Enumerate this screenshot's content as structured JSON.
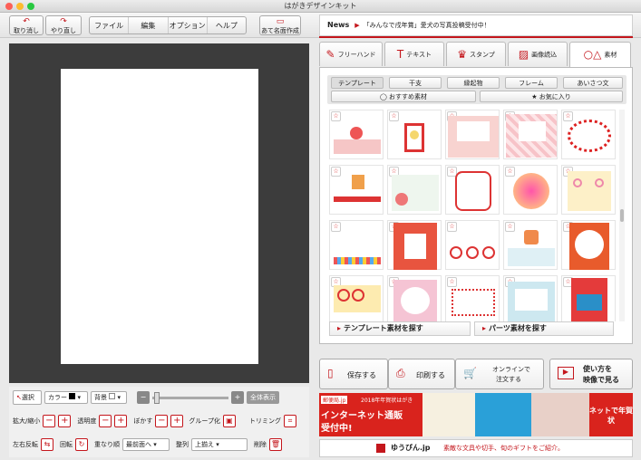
{
  "window": {
    "title": "はがきデザインキット"
  },
  "toolbar": {
    "undo": "取り消し",
    "redo": "やり直し",
    "menu": [
      "ファイル",
      "編集",
      "オプション",
      "ヘルプ"
    ],
    "address": "あて名面作成"
  },
  "news": {
    "label": "News",
    "text": "「みんなで戌年賞」愛犬の写真投稿受付中！"
  },
  "tabs": [
    {
      "label": "フリーハンド",
      "icon": "pen-icon"
    },
    {
      "label": "テキスト",
      "icon": "text-icon"
    },
    {
      "label": "スタンプ",
      "icon": "stamp-icon"
    },
    {
      "label": "画像読込",
      "icon": "image-icon"
    },
    {
      "label": "素材",
      "icon": "shapes-icon"
    }
  ],
  "categories": [
    "テンプレート",
    "干支",
    "縁起物",
    "フレーム",
    "あいさつ文"
  ],
  "recommend": "おすすめ素材",
  "favorites": "お気に入り",
  "search": {
    "template": "テンプレート素材を探す",
    "parts": "パーツ素材を探す"
  },
  "actions": {
    "save": "保存する",
    "print": "印刷する",
    "online1": "オンラインで",
    "online2": "注文する",
    "video1": "使い方を",
    "video2": "映像で見る"
  },
  "tools": {
    "select": "選択",
    "color": "カラー",
    "background": "背景",
    "fullview": "全体表示",
    "zoom": "拡大/縮小",
    "opacity": "透明度",
    "blur": "ぼかす",
    "group": "グループ化",
    "trim": "トリミング",
    "flip": "左右反転",
    "rotate": "回転",
    "order": "重なり順",
    "front": "最前面へ",
    "align": "整列",
    "align_val": "上揃え",
    "delete": "削除"
  },
  "banner": {
    "tag": "郵便局.jp",
    "year": "2018年年賀状はがき",
    "line1": "インターネット通販",
    "line2": "受付中!",
    "right": "ネットで年賀状"
  },
  "bottom": {
    "logo": "ゆうびん.jp",
    "text": "素敵な文具や切手、旬のギフトをご紹介。"
  },
  "colors": {
    "accent": "#c4161c"
  }
}
